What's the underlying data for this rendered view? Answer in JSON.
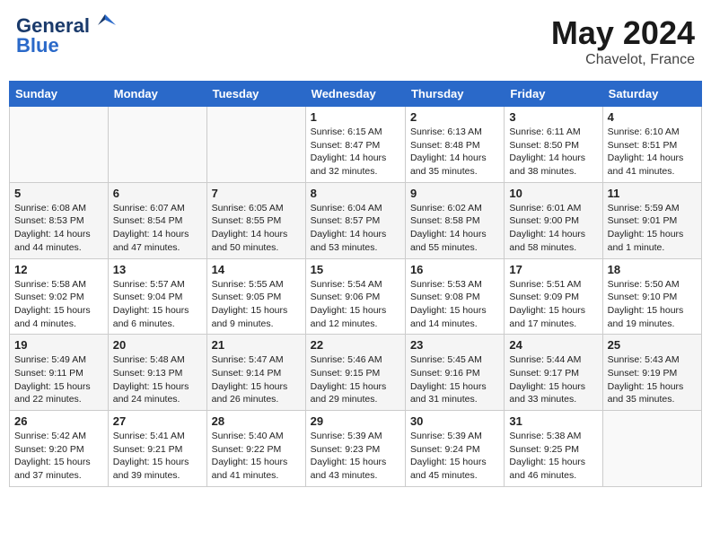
{
  "header": {
    "logo_line1": "General",
    "logo_line2": "Blue",
    "month": "May 2024",
    "location": "Chavelot, France"
  },
  "weekdays": [
    "Sunday",
    "Monday",
    "Tuesday",
    "Wednesday",
    "Thursday",
    "Friday",
    "Saturday"
  ],
  "weeks": [
    [
      {
        "day": "",
        "content": ""
      },
      {
        "day": "",
        "content": ""
      },
      {
        "day": "",
        "content": ""
      },
      {
        "day": "1",
        "content": "Sunrise: 6:15 AM\nSunset: 8:47 PM\nDaylight: 14 hours\nand 32 minutes."
      },
      {
        "day": "2",
        "content": "Sunrise: 6:13 AM\nSunset: 8:48 PM\nDaylight: 14 hours\nand 35 minutes."
      },
      {
        "day": "3",
        "content": "Sunrise: 6:11 AM\nSunset: 8:50 PM\nDaylight: 14 hours\nand 38 minutes."
      },
      {
        "day": "4",
        "content": "Sunrise: 6:10 AM\nSunset: 8:51 PM\nDaylight: 14 hours\nand 41 minutes."
      }
    ],
    [
      {
        "day": "5",
        "content": "Sunrise: 6:08 AM\nSunset: 8:53 PM\nDaylight: 14 hours\nand 44 minutes."
      },
      {
        "day": "6",
        "content": "Sunrise: 6:07 AM\nSunset: 8:54 PM\nDaylight: 14 hours\nand 47 minutes."
      },
      {
        "day": "7",
        "content": "Sunrise: 6:05 AM\nSunset: 8:55 PM\nDaylight: 14 hours\nand 50 minutes."
      },
      {
        "day": "8",
        "content": "Sunrise: 6:04 AM\nSunset: 8:57 PM\nDaylight: 14 hours\nand 53 minutes."
      },
      {
        "day": "9",
        "content": "Sunrise: 6:02 AM\nSunset: 8:58 PM\nDaylight: 14 hours\nand 55 minutes."
      },
      {
        "day": "10",
        "content": "Sunrise: 6:01 AM\nSunset: 9:00 PM\nDaylight: 14 hours\nand 58 minutes."
      },
      {
        "day": "11",
        "content": "Sunrise: 5:59 AM\nSunset: 9:01 PM\nDaylight: 15 hours\nand 1 minute."
      }
    ],
    [
      {
        "day": "12",
        "content": "Sunrise: 5:58 AM\nSunset: 9:02 PM\nDaylight: 15 hours\nand 4 minutes."
      },
      {
        "day": "13",
        "content": "Sunrise: 5:57 AM\nSunset: 9:04 PM\nDaylight: 15 hours\nand 6 minutes."
      },
      {
        "day": "14",
        "content": "Sunrise: 5:55 AM\nSunset: 9:05 PM\nDaylight: 15 hours\nand 9 minutes."
      },
      {
        "day": "15",
        "content": "Sunrise: 5:54 AM\nSunset: 9:06 PM\nDaylight: 15 hours\nand 12 minutes."
      },
      {
        "day": "16",
        "content": "Sunrise: 5:53 AM\nSunset: 9:08 PM\nDaylight: 15 hours\nand 14 minutes."
      },
      {
        "day": "17",
        "content": "Sunrise: 5:51 AM\nSunset: 9:09 PM\nDaylight: 15 hours\nand 17 minutes."
      },
      {
        "day": "18",
        "content": "Sunrise: 5:50 AM\nSunset: 9:10 PM\nDaylight: 15 hours\nand 19 minutes."
      }
    ],
    [
      {
        "day": "19",
        "content": "Sunrise: 5:49 AM\nSunset: 9:11 PM\nDaylight: 15 hours\nand 22 minutes."
      },
      {
        "day": "20",
        "content": "Sunrise: 5:48 AM\nSunset: 9:13 PM\nDaylight: 15 hours\nand 24 minutes."
      },
      {
        "day": "21",
        "content": "Sunrise: 5:47 AM\nSunset: 9:14 PM\nDaylight: 15 hours\nand 26 minutes."
      },
      {
        "day": "22",
        "content": "Sunrise: 5:46 AM\nSunset: 9:15 PM\nDaylight: 15 hours\nand 29 minutes."
      },
      {
        "day": "23",
        "content": "Sunrise: 5:45 AM\nSunset: 9:16 PM\nDaylight: 15 hours\nand 31 minutes."
      },
      {
        "day": "24",
        "content": "Sunrise: 5:44 AM\nSunset: 9:17 PM\nDaylight: 15 hours\nand 33 minutes."
      },
      {
        "day": "25",
        "content": "Sunrise: 5:43 AM\nSunset: 9:19 PM\nDaylight: 15 hours\nand 35 minutes."
      }
    ],
    [
      {
        "day": "26",
        "content": "Sunrise: 5:42 AM\nSunset: 9:20 PM\nDaylight: 15 hours\nand 37 minutes."
      },
      {
        "day": "27",
        "content": "Sunrise: 5:41 AM\nSunset: 9:21 PM\nDaylight: 15 hours\nand 39 minutes."
      },
      {
        "day": "28",
        "content": "Sunrise: 5:40 AM\nSunset: 9:22 PM\nDaylight: 15 hours\nand 41 minutes."
      },
      {
        "day": "29",
        "content": "Sunrise: 5:39 AM\nSunset: 9:23 PM\nDaylight: 15 hours\nand 43 minutes."
      },
      {
        "day": "30",
        "content": "Sunrise: 5:39 AM\nSunset: 9:24 PM\nDaylight: 15 hours\nand 45 minutes."
      },
      {
        "day": "31",
        "content": "Sunrise: 5:38 AM\nSunset: 9:25 PM\nDaylight: 15 hours\nand 46 minutes."
      },
      {
        "day": "",
        "content": ""
      }
    ]
  ]
}
